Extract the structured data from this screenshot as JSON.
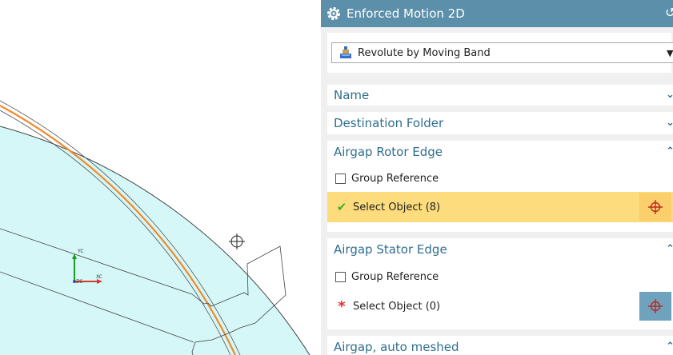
{
  "panel": {
    "title": "Enforced Motion 2D",
    "type_value": "Revolute by Moving Band",
    "sections": {
      "name": "Name",
      "destination_folder": "Destination Folder",
      "rotor_edge": "Airgap Rotor Edge",
      "stator_edge": "Airgap Stator Edge",
      "airgap_meshed": "Airgap, auto meshed"
    },
    "group_reference": "Group Reference",
    "rotor_select": "Select Object (8)",
    "stator_select": "Select Object (0)"
  },
  "viewport": {
    "triad": {
      "yc": "YC",
      "xc": "XC",
      "zc": "ZC"
    }
  },
  "colors": {
    "titlebar": "#5c8fa9",
    "link": "#2f6f8f",
    "active_row": "#fcdc7c",
    "active_button": "#fbd06c",
    "inactive_button": "#6ea2bd",
    "model_fill": "#d5f7f7",
    "airgap_edge": "#f08a28",
    "required_marker": "#e03030",
    "check_mark": "#3fae2a"
  }
}
